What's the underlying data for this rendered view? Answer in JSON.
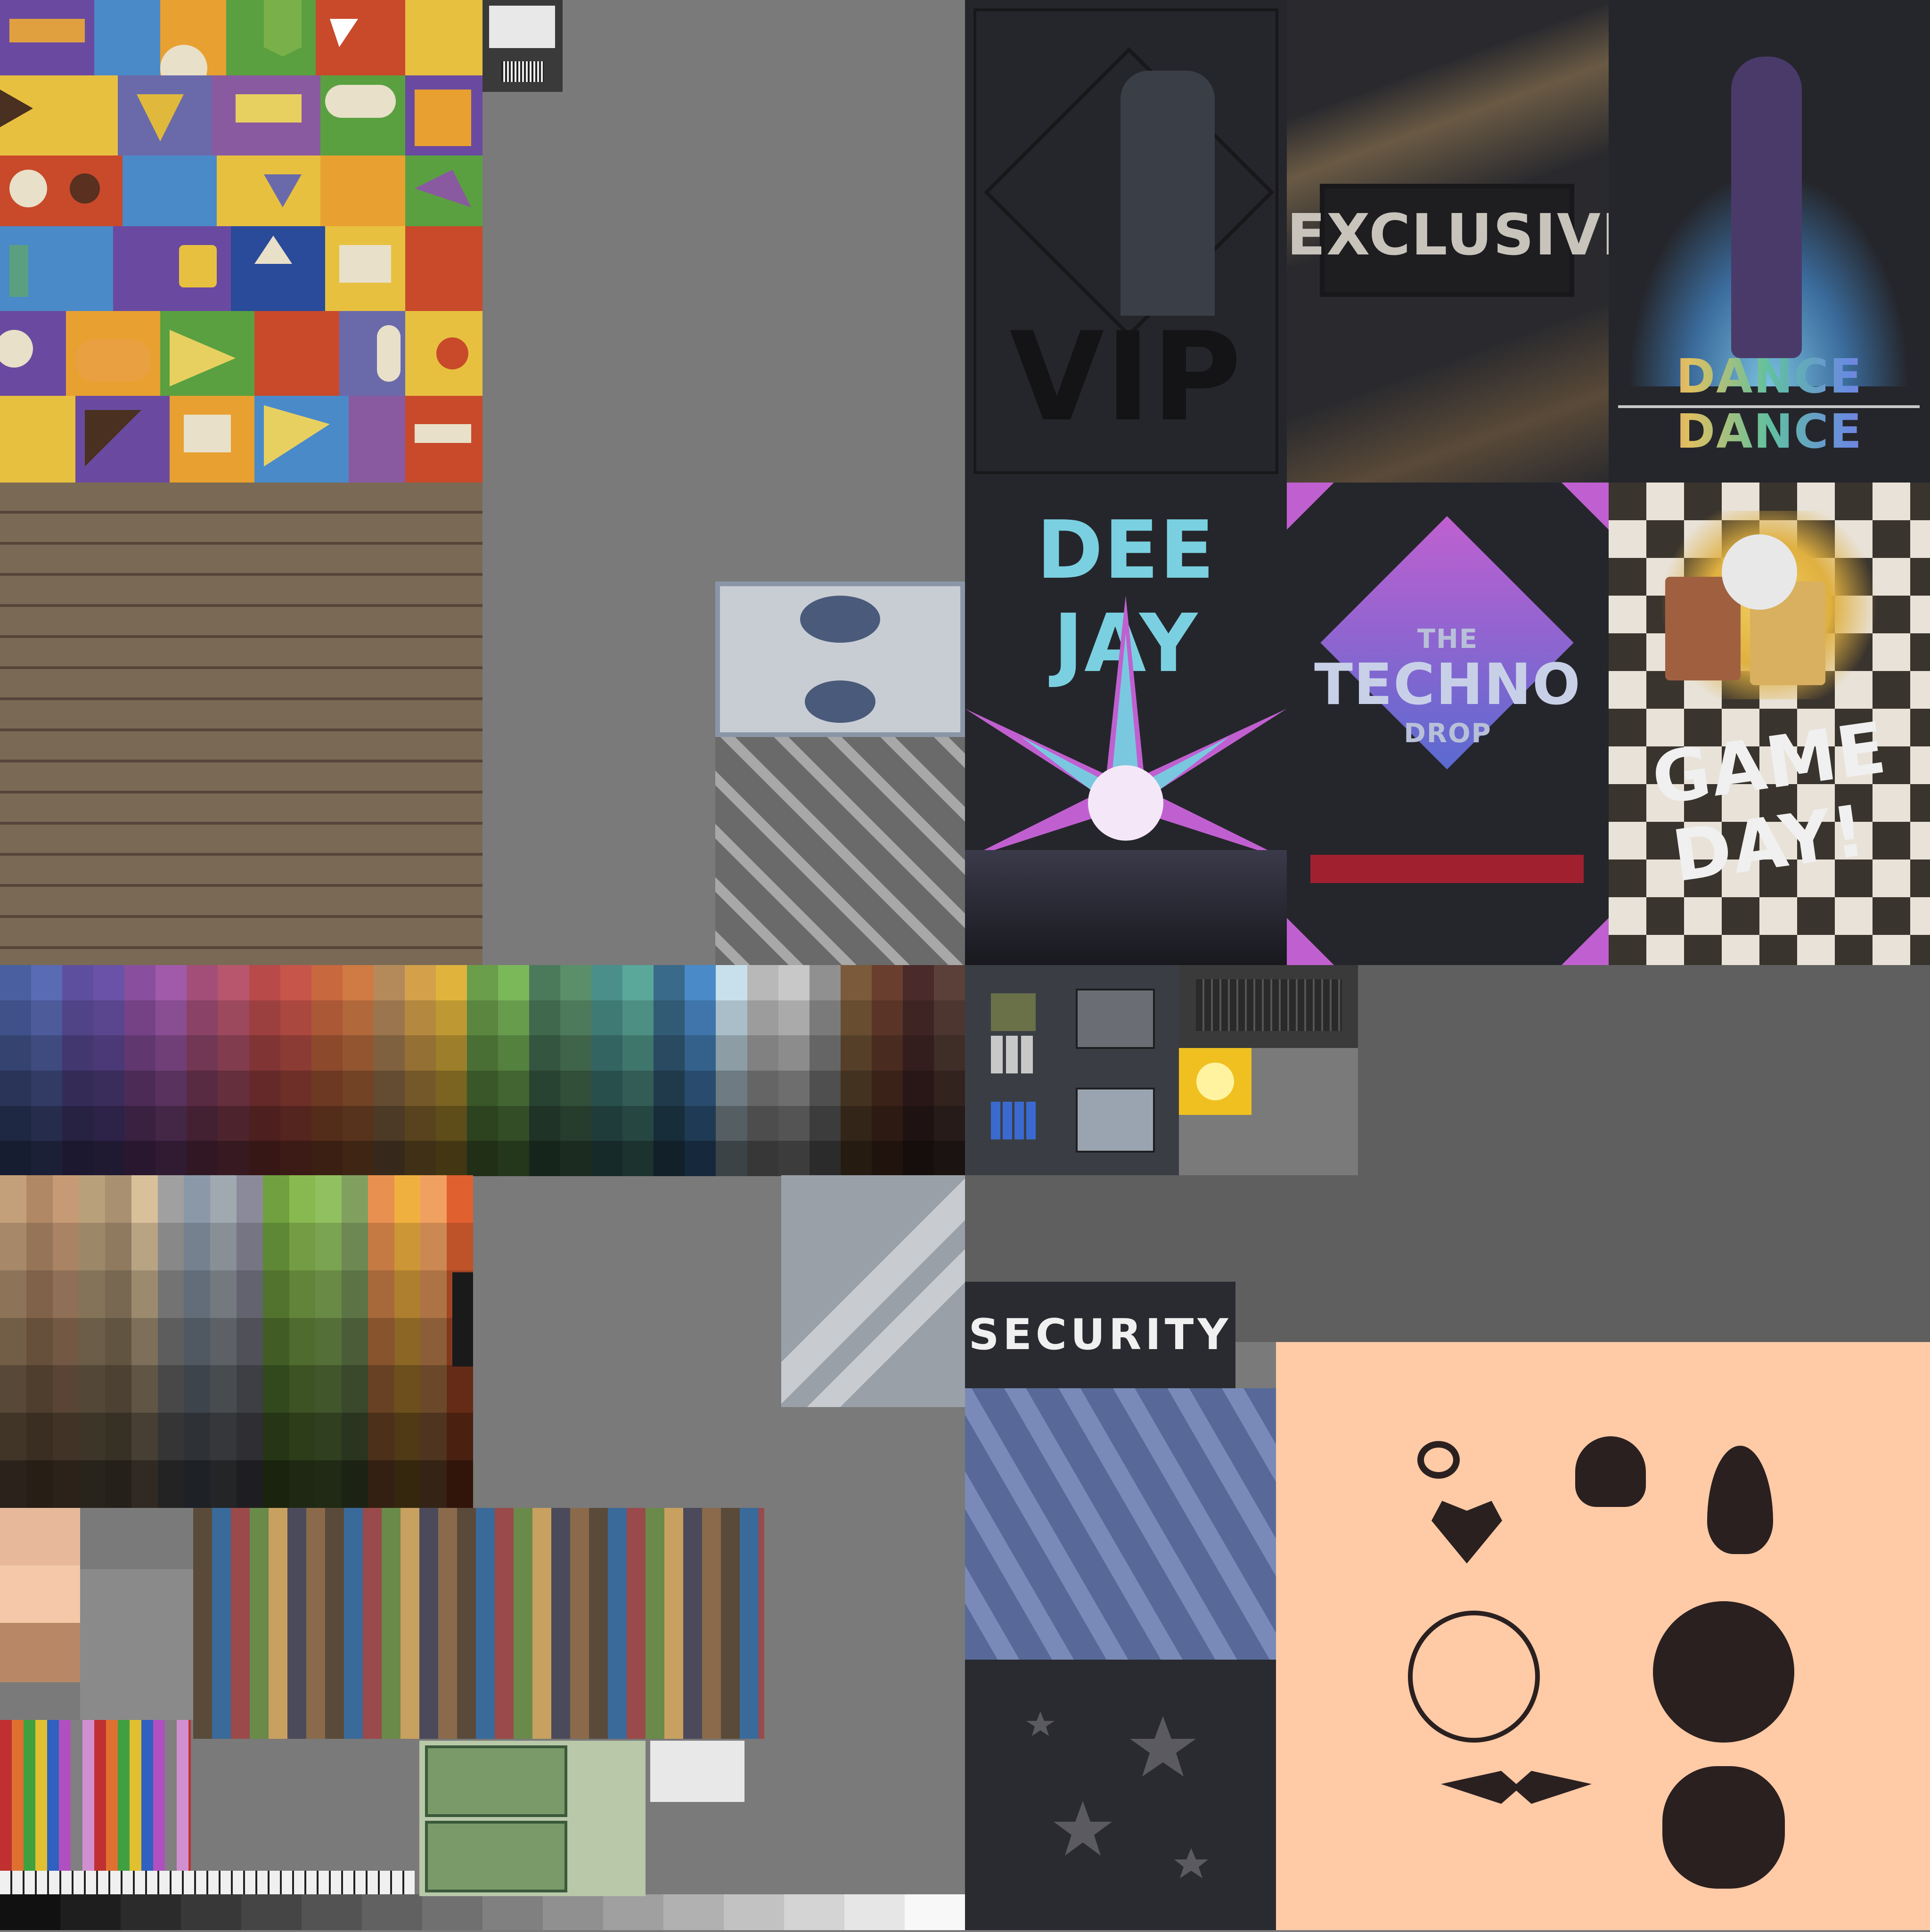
{
  "colors": {
    "background": "#7a7a7a",
    "dark_panel": "#5f5f5f",
    "poster_bg": "#25262b",
    "wood": "#7a6a55",
    "peach": "#ffcaa6",
    "decal_ink": "#2a2020",
    "security_blue": "#586999"
  },
  "posters": {
    "vip": {
      "title": "VIP"
    },
    "exclusive": {
      "title": "EXCLUSIVE"
    },
    "dance": {
      "title": "DANCE DANCE"
    },
    "deejay": {
      "title": "DEE JAY"
    },
    "techno": {
      "line1": "THE",
      "line2": "TECHNO",
      "line3": "DROP"
    },
    "gameday": {
      "line1": "GAME",
      "line2": "DAY!"
    }
  },
  "security": {
    "label": "SECURITY"
  },
  "decals": [
    "swirl-icon",
    "skull-icon",
    "flame-icon",
    "heart-icon",
    "spiderweb-icon",
    "gears-icon",
    "tribal-icon",
    "skull-badge-icon"
  ],
  "palette_top": {
    "columns": [
      "#4a5fa0",
      "#5a6bb5",
      "#5e4f9e",
      "#6a52a8",
      "#8a4e9e",
      "#a15aaa",
      "#a24e78",
      "#b8566e",
      "#b84a4a",
      "#c8554a",
      "#c8683f",
      "#d07a44",
      "#b58a5a",
      "#d4a04a",
      "#e0b43c",
      "#6a9e4a",
      "#7ab85a",
      "#4a7a5a",
      "#5a8f6a",
      "#4a8f8a",
      "#5aa89a",
      "#3a6a8a",
      "#4a8ac8",
      "#c8e0ec",
      "#b8b8b8",
      "#c8c8c8",
      "#909090",
      "#7a5a3a",
      "#6a3e2e",
      "#4a2a2a",
      "#5a4038"
    ],
    "shades": [
      1.0,
      0.85,
      0.7,
      0.55,
      0.42,
      0.3
    ]
  },
  "palette_mid": {
    "columns": [
      "#c4a07a",
      "#b08866",
      "#c79a76",
      "#b8a07a",
      "#a89070",
      "#d8c09a",
      "#a0a0a0",
      "#8a98a8",
      "#a0a8b0",
      "#8a8a9a",
      "#70a040",
      "#88b850",
      "#90c060",
      "#80a060",
      "#e89050",
      "#f0b040",
      "#f0a060",
      "#e06030"
    ],
    "shades": [
      1.0,
      0.85,
      0.72,
      0.58,
      0.45,
      0.33,
      0.22
    ]
  },
  "greyscale": [
    "#111111",
    "#1e1e1e",
    "#2b2b2b",
    "#383838",
    "#454545",
    "#535353",
    "#616161",
    "#707070",
    "#808080",
    "#909090",
    "#a0a0a0",
    "#b1b1b1",
    "#c2c2c2",
    "#d4d4d4",
    "#e6e6e6",
    "#f8f8f8"
  ]
}
